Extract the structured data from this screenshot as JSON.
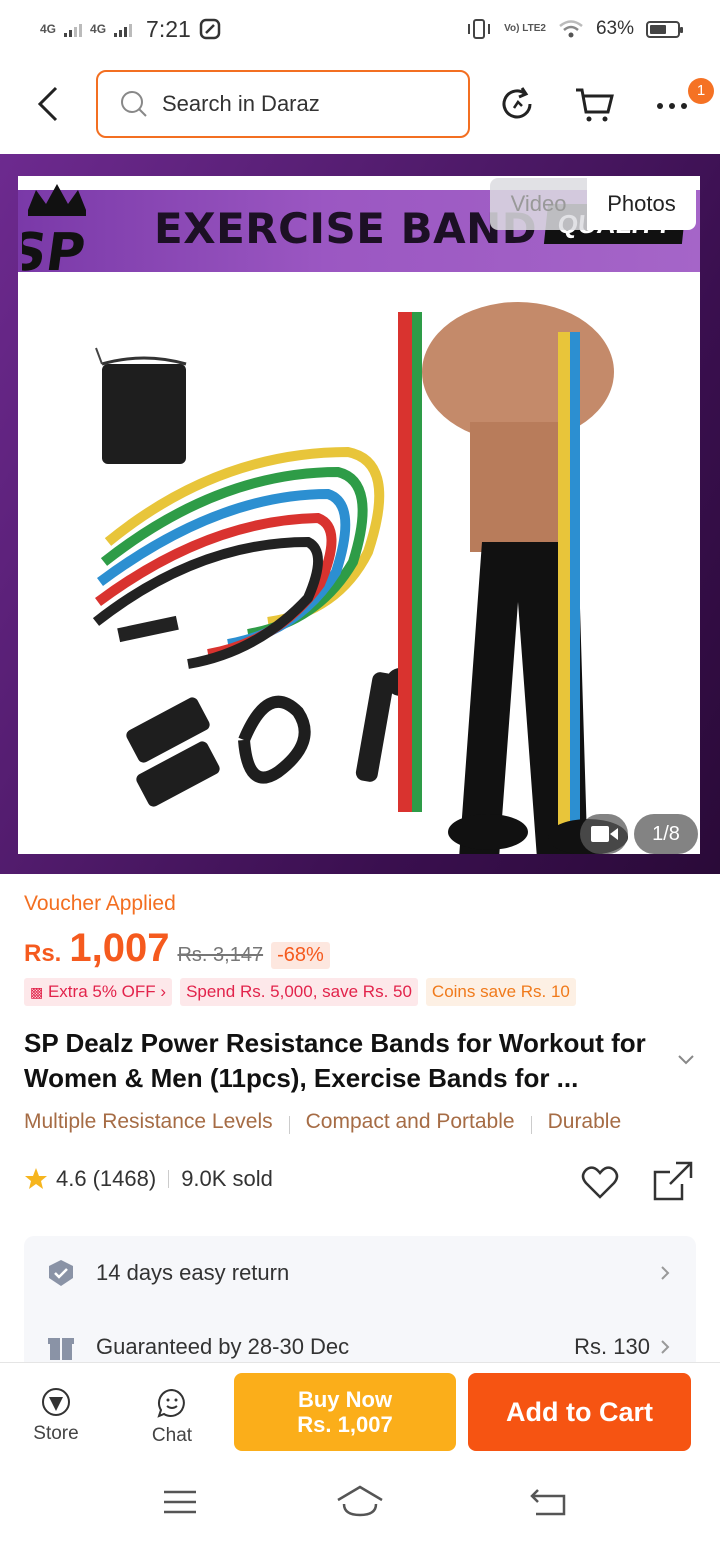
{
  "status_bar": {
    "net1": "4G",
    "net2": "4G",
    "time": "7:21",
    "volte": "Vo) LTE2",
    "battery": "63%",
    "battery_level": 0.63
  },
  "header": {
    "search_placeholder": "Search in Daraz",
    "cart_badge": "1"
  },
  "gallery": {
    "banner_title": "EXERCISE BAND",
    "banner_quality": "QUALITY",
    "tab_video": "Video",
    "tab_photos": "Photos",
    "counter": "1/8"
  },
  "product": {
    "voucher": "Voucher Applied",
    "currency": "Rs.",
    "price": "1,007",
    "old_price": "Rs. 3,147",
    "discount": "-68%",
    "promos": [
      "Extra 5% OFF",
      "Spend Rs. 5,000, save Rs. 50",
      "Coins save Rs. 10"
    ],
    "title": "SP Dealz  Power Resistance Bands for Workout for Women & Men (11pcs), Exercise Bands for ...",
    "tags": [
      "Multiple Resistance Levels",
      "Compact and Portable",
      "Durable"
    ],
    "rating": "4.6",
    "reviews": "(1468)",
    "sold": "9.0K sold"
  },
  "service": {
    "return": "14 days easy return",
    "delivery": "Guaranteed by 28-30 Dec",
    "delivery_fee": "Rs. 130"
  },
  "bottom": {
    "store": "Store",
    "chat": "Chat",
    "buy_now": "Buy Now",
    "buy_now_price": "Rs. 1,007",
    "add_to_cart": "Add to Cart"
  },
  "colors": {
    "brand_orange": "#f65412",
    "buy_now": "#fbae1a",
    "price": "#f55a1e"
  }
}
